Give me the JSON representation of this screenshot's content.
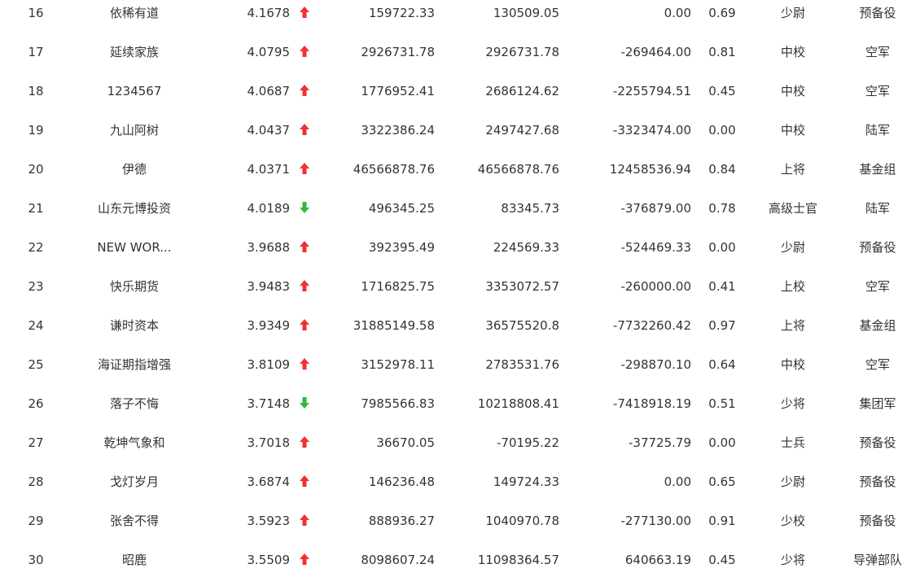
{
  "colors": {
    "text": "#333333",
    "up": "#f23030",
    "down": "#2dbb3d",
    "background": "#ffffff"
  },
  "rows": [
    {
      "rank": "16",
      "name": "依稀有道",
      "score": "4.1678",
      "trend": "up",
      "trend_icon": "arrow-up-icon",
      "v1": "159722.33",
      "v2": "130509.05",
      "v3": "0.00",
      "ratio": "0.69",
      "rank_title": "少尉",
      "group": "预备役"
    },
    {
      "rank": "17",
      "name": "延续家族",
      "score": "4.0795",
      "trend": "up",
      "trend_icon": "arrow-up-icon",
      "v1": "2926731.78",
      "v2": "2926731.78",
      "v3": "-269464.00",
      "ratio": "0.81",
      "rank_title": "中校",
      "group": "空军"
    },
    {
      "rank": "18",
      "name": "1234567",
      "score": "4.0687",
      "trend": "up",
      "trend_icon": "arrow-up-icon",
      "v1": "1776952.41",
      "v2": "2686124.62",
      "v3": "-2255794.51",
      "ratio": "0.45",
      "rank_title": "中校",
      "group": "空军"
    },
    {
      "rank": "19",
      "name": "九山阿树",
      "score": "4.0437",
      "trend": "up",
      "trend_icon": "arrow-up-icon",
      "v1": "3322386.24",
      "v2": "2497427.68",
      "v3": "-3323474.00",
      "ratio": "0.00",
      "rank_title": "中校",
      "group": "陆军"
    },
    {
      "rank": "20",
      "name": "伊德",
      "score": "4.0371",
      "trend": "up",
      "trend_icon": "arrow-up-icon",
      "v1": "46566878.76",
      "v2": "46566878.76",
      "v3": "12458536.94",
      "ratio": "0.84",
      "rank_title": "上将",
      "group": "基金组"
    },
    {
      "rank": "21",
      "name": "山东元博投资",
      "score": "4.0189",
      "trend": "down",
      "trend_icon": "arrow-down-icon",
      "v1": "496345.25",
      "v2": "83345.73",
      "v3": "-376879.00",
      "ratio": "0.78",
      "rank_title": "高级士官",
      "group": "陆军"
    },
    {
      "rank": "22",
      "name": "NEW WOR...",
      "score": "3.9688",
      "trend": "up",
      "trend_icon": "arrow-up-icon",
      "v1": "392395.49",
      "v2": "224569.33",
      "v3": "-524469.33",
      "ratio": "0.00",
      "rank_title": "少尉",
      "group": "预备役"
    },
    {
      "rank": "23",
      "name": "快乐期货",
      "score": "3.9483",
      "trend": "up",
      "trend_icon": "arrow-up-icon",
      "v1": "1716825.75",
      "v2": "3353072.57",
      "v3": "-260000.00",
      "ratio": "0.41",
      "rank_title": "上校",
      "group": "空军"
    },
    {
      "rank": "24",
      "name": "谦时资本",
      "score": "3.9349",
      "trend": "up",
      "trend_icon": "arrow-up-icon",
      "v1": "31885149.58",
      "v2": "36575520.8",
      "v3": "-7732260.42",
      "ratio": "0.97",
      "rank_title": "上将",
      "group": "基金组"
    },
    {
      "rank": "25",
      "name": "海证期指增强",
      "score": "3.8109",
      "trend": "up",
      "trend_icon": "arrow-up-icon",
      "v1": "3152978.11",
      "v2": "2783531.76",
      "v3": "-298870.10",
      "ratio": "0.64",
      "rank_title": "中校",
      "group": "空军"
    },
    {
      "rank": "26",
      "name": "落子不悔",
      "score": "3.7148",
      "trend": "down",
      "trend_icon": "arrow-down-icon",
      "v1": "7985566.83",
      "v2": "10218808.41",
      "v3": "-7418918.19",
      "ratio": "0.51",
      "rank_title": "少将",
      "group": "集团军"
    },
    {
      "rank": "27",
      "name": "乾坤气象和",
      "score": "3.7018",
      "trend": "up",
      "trend_icon": "arrow-up-icon",
      "v1": "36670.05",
      "v2": "-70195.22",
      "v3": "-37725.79",
      "ratio": "0.00",
      "rank_title": "士兵",
      "group": "预备役"
    },
    {
      "rank": "28",
      "name": "戈灯岁月",
      "score": "3.6874",
      "trend": "up",
      "trend_icon": "arrow-up-icon",
      "v1": "146236.48",
      "v2": "149724.33",
      "v3": "0.00",
      "ratio": "0.65",
      "rank_title": "少尉",
      "group": "预备役"
    },
    {
      "rank": "29",
      "name": "张舍不得",
      "score": "3.5923",
      "trend": "up",
      "trend_icon": "arrow-up-icon",
      "v1": "888936.27",
      "v2": "1040970.78",
      "v3": "-277130.00",
      "ratio": "0.91",
      "rank_title": "少校",
      "group": "预备役"
    },
    {
      "rank": "30",
      "name": "昭鹿",
      "score": "3.5509",
      "trend": "up",
      "trend_icon": "arrow-up-icon",
      "v1": "8098607.24",
      "v2": "11098364.57",
      "v3": "640663.19",
      "ratio": "0.45",
      "rank_title": "少将",
      "group": "导弹部队"
    }
  ]
}
